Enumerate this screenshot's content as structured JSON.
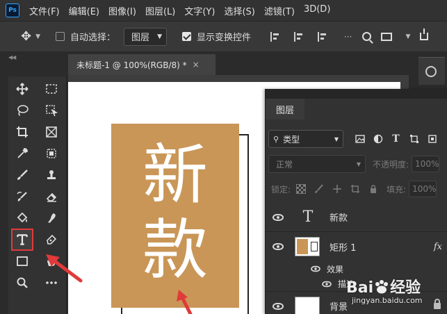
{
  "menubar": {
    "logo": "Ps",
    "items": [
      "文件(F)",
      "编辑(E)",
      "图像(I)",
      "图层(L)",
      "文字(Y)",
      "选择(S)",
      "滤镜(T)",
      "3D(D)"
    ]
  },
  "options": {
    "auto_select_label": "自动选择：",
    "auto_select_value": "图层",
    "show_transform_label": "显示变换控件"
  },
  "document": {
    "tab_title": "未标题-1 @ 100%(RGB/8) *",
    "close": "×",
    "char1": "新",
    "char2": "款",
    "fill_color": "#c99657"
  },
  "layers_panel": {
    "tab": "图层",
    "filter_label": "类型",
    "filter_icon_t": "T",
    "blend_mode": "正常",
    "opacity_label": "不透明度:",
    "opacity_value": "100%",
    "lock_label": "锁定:",
    "fill_label": "填充:",
    "fill_value": "100%",
    "layers": [
      {
        "name": "新款",
        "type": "text",
        "thumb": "T"
      },
      {
        "name": "矩形 1",
        "type": "shape",
        "fx": "fx"
      },
      {
        "name": "效果",
        "type": "effects"
      },
      {
        "name": "描边",
        "type": "effect-item"
      },
      {
        "name": "背景",
        "type": "background"
      }
    ]
  },
  "watermark": {
    "brand": "Bai",
    "brand_cn": "经验",
    "url": "jingyan.baidu.com"
  },
  "colors": {
    "highlight": "#e03a3a",
    "arrow": "#e03a3a"
  }
}
